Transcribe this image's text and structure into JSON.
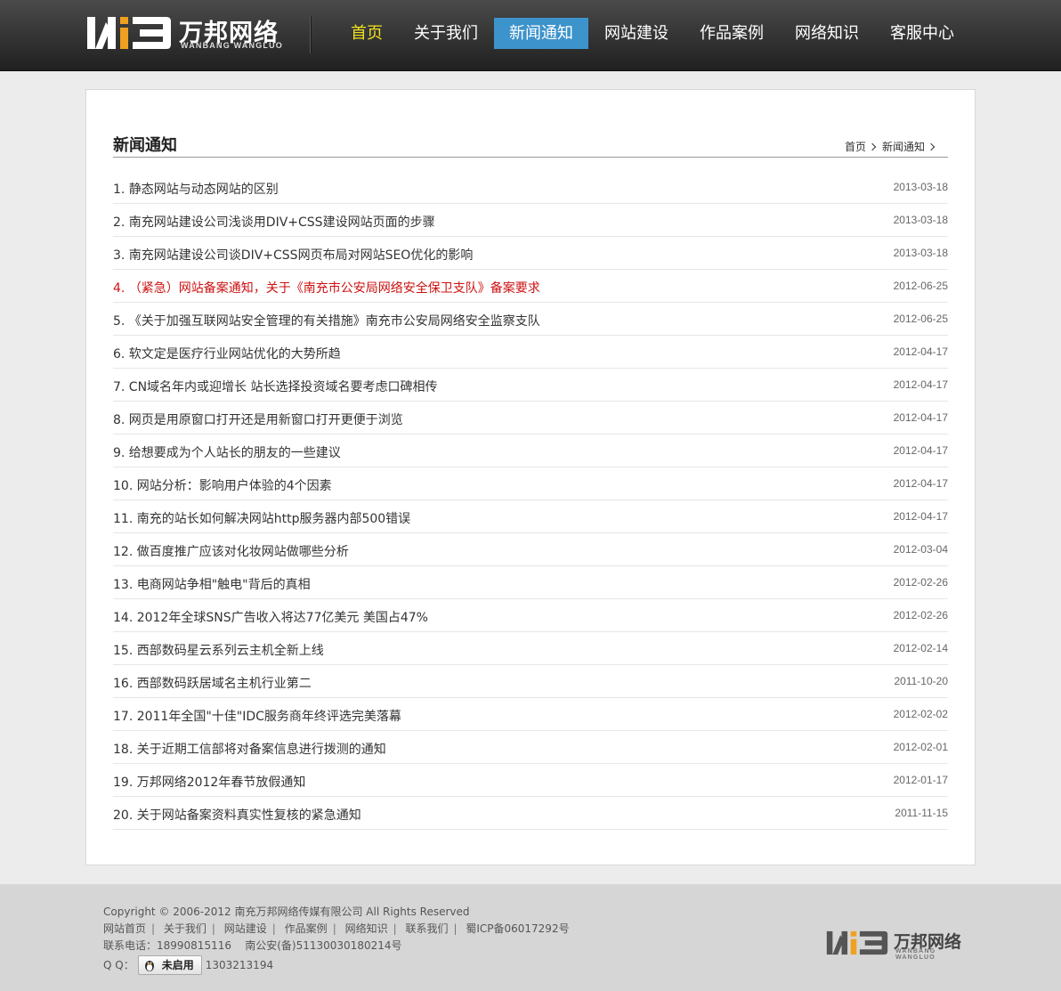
{
  "brand": {
    "name_cn": "万邦网络",
    "name_en": "WANBANG WANGLUO"
  },
  "nav": [
    {
      "label": "首页"
    },
    {
      "label": "关于我们"
    },
    {
      "label": "新闻通知"
    },
    {
      "label": "网站建设"
    },
    {
      "label": "作品案例"
    },
    {
      "label": "网络知识"
    },
    {
      "label": "客服中心"
    }
  ],
  "page": {
    "title": "新闻通知",
    "breadcrumb": [
      "首页",
      "新闻通知"
    ]
  },
  "news": [
    {
      "title": "1. 静态网站与动态网站的区别",
      "date": "2013-03-18"
    },
    {
      "title": "2. 南充网站建设公司浅谈用DIV+CSS建设网站页面的步骤",
      "date": "2013-03-18"
    },
    {
      "title": "3. 南充网站建设公司谈DIV+CSS网页布局对网站SEO优化的影响",
      "date": "2013-03-18"
    },
    {
      "title": "4. （紧急）网站备案通知，关于《南充市公安局网络安全保卫支队》备案要求",
      "date": "2012-06-25"
    },
    {
      "title": "5. 《关于加强互联网站安全管理的有关措施》南充市公安局网络安全监察支队",
      "date": "2012-06-25"
    },
    {
      "title": "6. 软文定是医疗行业网站优化的大势所趋",
      "date": "2012-04-17"
    },
    {
      "title": "7. CN域名年内或迎增长 站长选择投资域名要考虑口碑相传",
      "date": "2012-04-17"
    },
    {
      "title": "8. 网页是用原窗口打开还是用新窗口打开更便于浏览",
      "date": "2012-04-17"
    },
    {
      "title": "9. 给想要成为个人站长的朋友的一些建议",
      "date": "2012-04-17"
    },
    {
      "title": "10. 网站分析：影响用户体验的4个因素",
      "date": "2012-04-17"
    },
    {
      "title": "11. 南充的站长如何解决网站http服务器内部500错误",
      "date": "2012-04-17"
    },
    {
      "title": "12. 做百度推广应该对化妆网站做哪些分析",
      "date": "2012-03-04"
    },
    {
      "title": "13. 电商网站争相\"触电\"背后的真相",
      "date": "2012-02-26"
    },
    {
      "title": "14. 2012年全球SNS广告收入将达77亿美元 美国占47%",
      "date": "2012-02-26"
    },
    {
      "title": "15. 西部数码星云系列云主机全新上线",
      "date": "2012-02-14"
    },
    {
      "title": "16. 西部数码跃居域名主机行业第二",
      "date": "2011-10-20"
    },
    {
      "title": "17. 2011年全国\"十佳\"IDC服务商年终评选完美落幕",
      "date": "2012-02-02"
    },
    {
      "title": "18. 关于近期工信部将对备案信息进行拨测的通知",
      "date": "2012-02-01"
    },
    {
      "title": "19. 万邦网络2012年春节放假通知",
      "date": "2012-01-17"
    },
    {
      "title": "20. 关于网站备案资料真实性复核的紧急通知",
      "date": "2011-11-15"
    }
  ],
  "footer": {
    "copyright": "Copyright © 2006-2012 南充万邦网络传媒有限公司 All Rights Reserved",
    "links": [
      "网站首页",
      "关于我们",
      "网站建设",
      "作品案例",
      "网络知识",
      "联系我们"
    ],
    "icp": "蜀ICP备06017292号",
    "contact": "联系电话：18990815116    南公安(备)51130030180214号",
    "qq_label": "Q Q：",
    "qq_button": "未启用",
    "qq_number": "1303213194"
  },
  "colors": {
    "nav_active": "#3d93cc",
    "nav_home": "#f0e020",
    "urgent": "#cc1111"
  }
}
